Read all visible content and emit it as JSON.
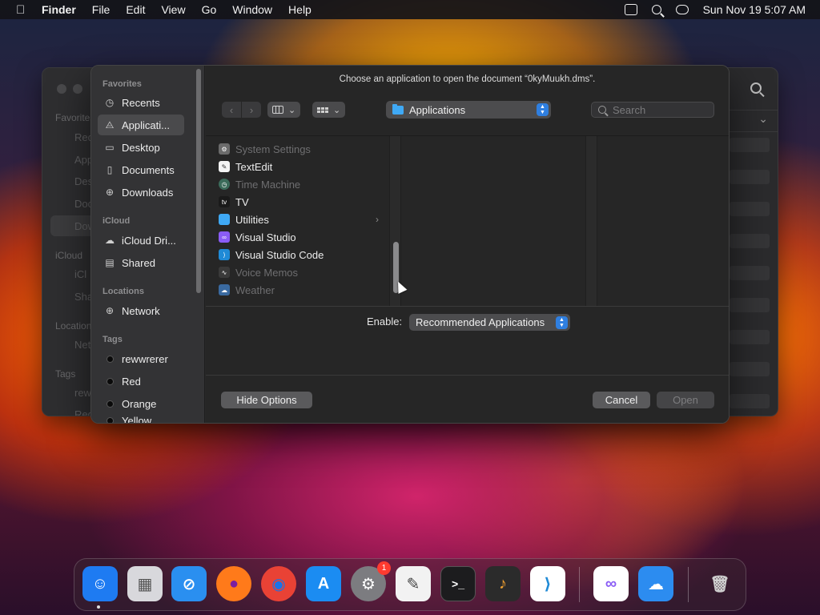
{
  "menubar": {
    "apple": "",
    "app_name": "Finder",
    "menus": [
      "File",
      "Edit",
      "View",
      "Go",
      "Window",
      "Help"
    ],
    "clock": "Sun Nov 19  5:07 AM"
  },
  "background_window": {
    "sections": [
      "Favorites",
      "iCloud",
      "Locations",
      "Tags"
    ],
    "items": [
      "Rec",
      "App",
      "Des",
      "Doc",
      "Dow",
      "iCl",
      "Sha",
      "Net",
      "rew",
      "Red"
    ]
  },
  "dialog": {
    "title": "Choose an application to open the document “0kyMuukh.dms”.",
    "sidebar": {
      "favorites_label": "Favorites",
      "favorites": [
        {
          "label": "Recents",
          "icon": "clock-icon"
        },
        {
          "label": "Applicati...",
          "icon": "applications-icon"
        },
        {
          "label": "Desktop",
          "icon": "desktop-icon"
        },
        {
          "label": "Documents",
          "icon": "document-icon"
        },
        {
          "label": "Downloads",
          "icon": "downloads-icon"
        }
      ],
      "icloud_label": "iCloud",
      "icloud": [
        {
          "label": "iCloud Dri...",
          "icon": "cloud-icon"
        },
        {
          "label": "Shared",
          "icon": "shared-folder-icon"
        }
      ],
      "locations_label": "Locations",
      "locations": [
        {
          "label": "Network",
          "icon": "globe-icon"
        }
      ],
      "tags_label": "Tags",
      "tags": [
        {
          "label": "rewwrerer"
        },
        {
          "label": "Red"
        },
        {
          "label": "Orange"
        },
        {
          "label": "Yellow"
        }
      ]
    },
    "toolbar": {
      "back": "‹",
      "forward": "›",
      "location": "Applications",
      "search_placeholder": "Search"
    },
    "apps": [
      {
        "label": "System Settings",
        "enabled": false,
        "icon": "gear-icon",
        "color": "#6b6b6b"
      },
      {
        "label": "TextEdit",
        "enabled": true,
        "icon": "textedit-icon",
        "color": "#f4f4f4"
      },
      {
        "label": "Time Machine",
        "enabled": false,
        "icon": "time-machine-icon",
        "color": "#3b6b5a"
      },
      {
        "label": "TV",
        "enabled": true,
        "icon": "tv-icon",
        "color": "#1a1a1a"
      },
      {
        "label": "Utilities",
        "enabled": true,
        "icon": "folder-icon",
        "color": "#3fa9f5"
      },
      {
        "label": "Visual Studio",
        "enabled": true,
        "icon": "visual-studio-icon",
        "color": "#8a5cf5"
      },
      {
        "label": "Visual Studio Code",
        "enabled": true,
        "icon": "vscode-icon",
        "color": "#1f8ad6"
      },
      {
        "label": "Voice Memos",
        "enabled": false,
        "icon": "waveform-icon",
        "color": "#3a3a3a"
      },
      {
        "label": "Weather",
        "enabled": false,
        "icon": "weather-icon",
        "color": "#3a6aa0"
      }
    ],
    "enable_label": "Enable:",
    "enable_value": "Recommended Applications",
    "hide_options": "Hide Options",
    "cancel": "Cancel",
    "open": "Open"
  },
  "dock": {
    "items": [
      {
        "name": "finder-icon",
        "glyph": "☺",
        "color": "#1e7bf2"
      },
      {
        "name": "launchpad-icon",
        "glyph": "▦",
        "color": "#d8d8dc"
      },
      {
        "name": "safari-icon",
        "glyph": "⊘",
        "color": "#2a8ff0"
      },
      {
        "name": "firefox-icon",
        "glyph": "●",
        "color": "#ff7a1a"
      },
      {
        "name": "chrome-icon",
        "glyph": "◉",
        "color": "#e94235"
      },
      {
        "name": "app-store-icon",
        "glyph": "A",
        "color": "#1b8cf2"
      },
      {
        "name": "system-settings-icon",
        "glyph": "⚙",
        "color": "#7c7c80"
      },
      {
        "name": "textedit-icon",
        "glyph": "✎",
        "color": "#f2f2f2"
      },
      {
        "name": "terminal-icon",
        "glyph": ">_",
        "color": "#1c1c1e"
      },
      {
        "name": "garageband-icon",
        "glyph": "♪",
        "color": "#2b2b2b"
      },
      {
        "name": "vscode-icon",
        "glyph": "⟩",
        "color": "#ffffff"
      },
      {
        "name": "visual-studio-icon",
        "glyph": "∞",
        "color": "#ffffff"
      },
      {
        "name": "weather-icon",
        "glyph": "☁",
        "color": "#2c8cf0"
      },
      {
        "name": "trash-icon",
        "glyph": "🗑",
        "color": "transparent"
      }
    ],
    "settings_badge": "1"
  }
}
